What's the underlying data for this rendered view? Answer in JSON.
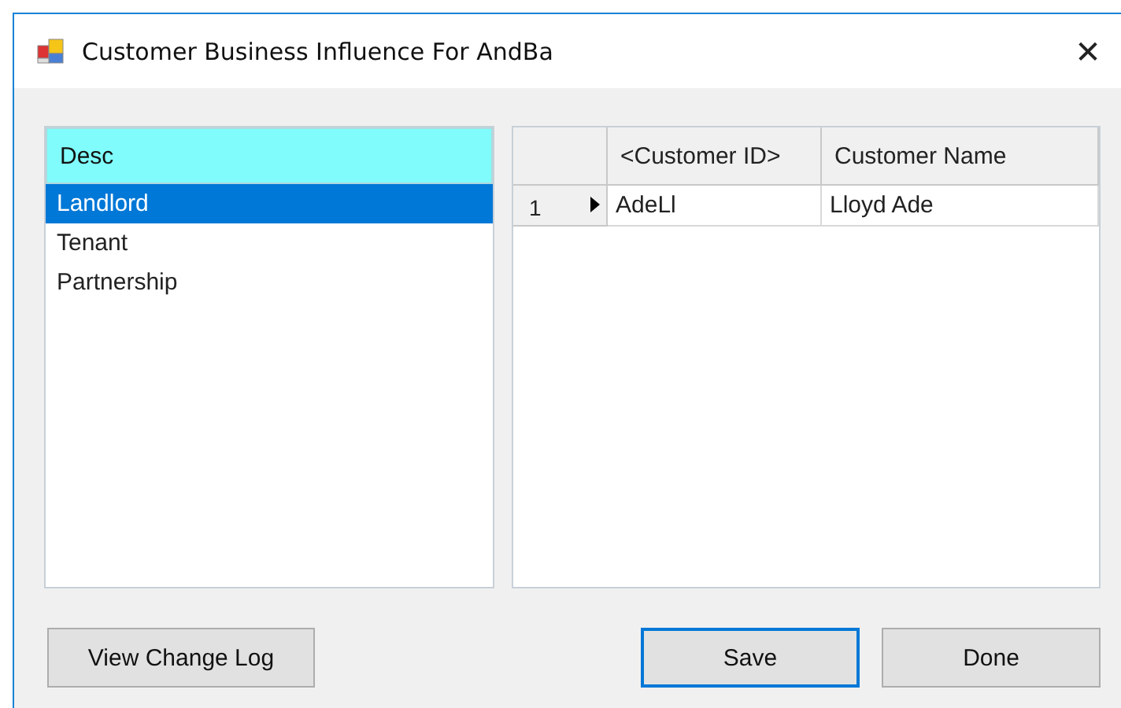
{
  "window": {
    "title": "Customer Business Influence For AndBa",
    "close": "✕"
  },
  "list": {
    "header": "Desc",
    "items": [
      {
        "label": "Landlord",
        "selected": true
      },
      {
        "label": "Tenant",
        "selected": false
      },
      {
        "label": "Partnership",
        "selected": false
      }
    ]
  },
  "grid": {
    "columns": [
      "<Customer ID>",
      "Customer Name"
    ],
    "rows": [
      {
        "number": "1",
        "current": true,
        "cells": [
          "AdeLl",
          "Lloyd Ade"
        ]
      }
    ]
  },
  "left_buttons": [
    {
      "label": "View Change Log",
      "focused": false
    }
  ],
  "right_buttons": [
    {
      "label": "Save",
      "focused": true
    },
    {
      "label": "Done",
      "focused": false
    }
  ]
}
